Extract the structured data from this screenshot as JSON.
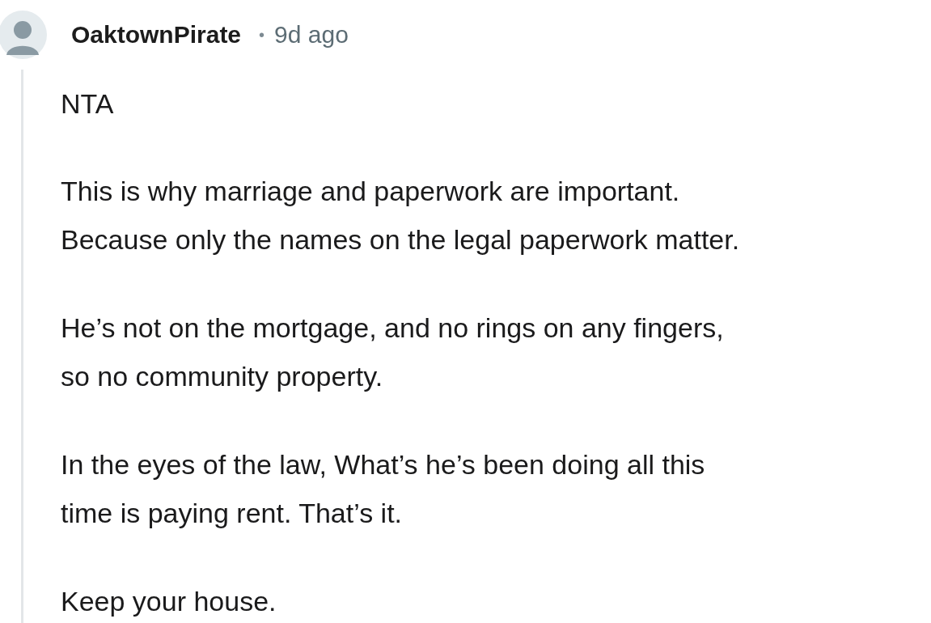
{
  "comment": {
    "author": "OaktownPirate",
    "separator": "•",
    "time": "9d ago",
    "paragraphs": [
      {
        "lines": [
          "NTA"
        ]
      },
      {
        "lines": [
          "This is why marriage and paperwork are important.",
          "Because only the names on the legal paperwork matter."
        ]
      },
      {
        "lines": [
          "He’s not on the mortgage, and no rings on any fingers,",
          "so no community property."
        ]
      },
      {
        "lines": [
          "In the eyes of the law, What’s he’s been doing all this",
          "time is paying rent. That’s it."
        ]
      },
      {
        "lines": [
          "Keep your house."
        ]
      }
    ]
  }
}
